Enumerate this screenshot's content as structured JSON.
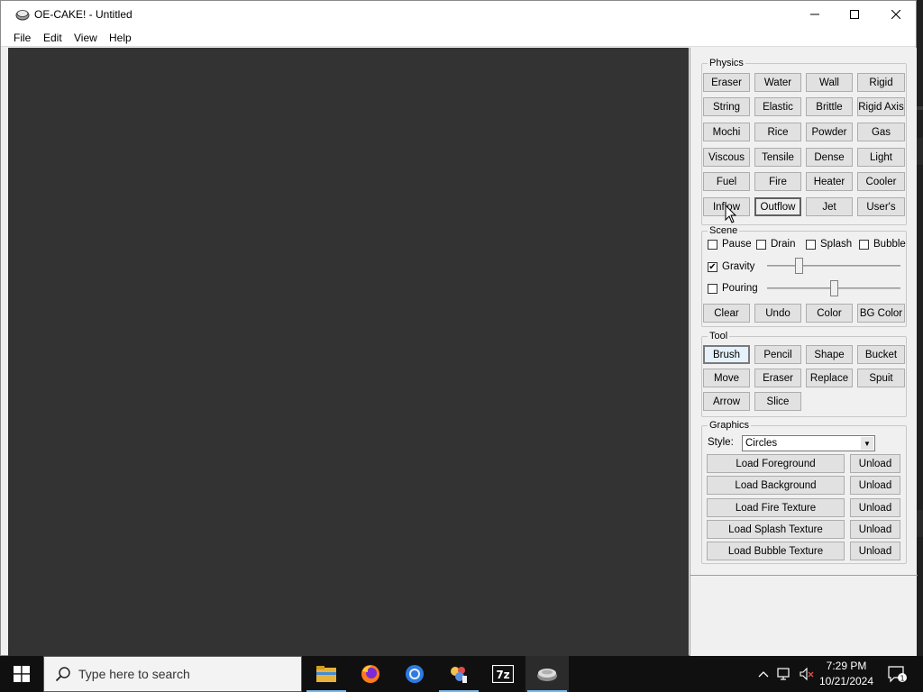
{
  "window": {
    "title": "OE-CAKE! - Untitled"
  },
  "menu": [
    "File",
    "Edit",
    "View",
    "Help"
  ],
  "physics": {
    "legend": "Physics",
    "buttons": [
      "Eraser",
      "Water",
      "Wall",
      "Rigid",
      "String",
      "Elastic",
      "Brittle",
      "Rigid Axis",
      "Mochi",
      "Rice",
      "Powder",
      "Gas",
      "Viscous",
      "Tensile",
      "Dense",
      "Light",
      "Fuel",
      "Fire",
      "Heater",
      "Cooler",
      "Inflow",
      "Outflow",
      "Jet",
      "User's"
    ],
    "selected": "Outflow"
  },
  "scene": {
    "legend": "Scene",
    "checkboxes": [
      {
        "label": "Pause",
        "checked": false
      },
      {
        "label": "Drain",
        "checked": false
      },
      {
        "label": "Splash",
        "checked": false
      },
      {
        "label": "Bubble",
        "checked": false
      }
    ],
    "gravity": {
      "label": "Gravity",
      "checked": true,
      "level": 0.22
    },
    "pouring": {
      "label": "Pouring",
      "checked": false,
      "level": 0.5
    },
    "buttons": [
      "Clear",
      "Undo",
      "Color",
      "BG Color"
    ]
  },
  "tool": {
    "legend": "Tool",
    "buttons": [
      "Brush",
      "Pencil",
      "Shape",
      "Bucket",
      "Move",
      "Eraser",
      "Replace",
      "Spuit",
      "Arrow",
      "Slice"
    ],
    "selected": "Brush"
  },
  "graphics": {
    "legend": "Graphics",
    "style_label": "Style:",
    "style_value": "Circles",
    "loaders": [
      {
        "load": "Load Foreground",
        "unload": "Unload"
      },
      {
        "load": "Load Background",
        "unload": "Unload"
      },
      {
        "load": "Load Fire Texture",
        "unload": "Unload"
      },
      {
        "load": "Load Splash Texture",
        "unload": "Unload"
      },
      {
        "load": "Load Bubble Texture",
        "unload": "Unload"
      }
    ]
  },
  "taskbar": {
    "search_placeholder": "Type here to search",
    "apps": [
      "file-explorer-icon",
      "firefox-icon",
      "chrome-icon",
      "paint-app-icon",
      "7zip-icon",
      "oe-cake-icon"
    ],
    "sevenzip_label": "7z",
    "time": "7:29 PM",
    "date": "10/21/2024",
    "notification_count": "1"
  }
}
